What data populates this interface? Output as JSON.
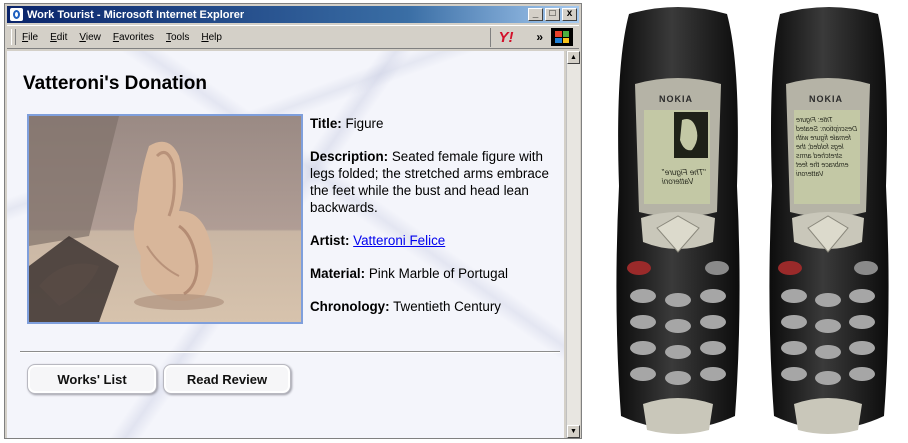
{
  "window": {
    "title": "Work Tourist - Microsoft Internet Explorer",
    "controls": {
      "minimize": "_",
      "maximize": "□",
      "close": "x"
    }
  },
  "menubar": {
    "items": [
      "File",
      "Edit",
      "View",
      "Favorites",
      "Tools",
      "Help"
    ],
    "yahoo_label": "Y!",
    "chevron": "»"
  },
  "page": {
    "title": "Vatteroni's Donation",
    "details": {
      "title_label": "Title:",
      "title_value": "Figure",
      "description_label": "Description:",
      "description_value": "Seated female figure with legs folded; the stretched arms embrace the feet while the bust and head lean backwards.",
      "artist_label": "Artist:",
      "artist_value": "Vatteroni Felice",
      "material_label": "Material:",
      "material_value": "Pink Marble of Portugal",
      "chronology_label": "Chronology:",
      "chronology_value": "Twentieth Century"
    },
    "buttons": {
      "works_list": "Works' List",
      "read_review": "Read Review"
    }
  },
  "phones": [
    {
      "brand": "NOKIA",
      "screen_text": "\"The Figure\"\nVatteroni"
    },
    {
      "brand": "NOKIA",
      "screen_text": "Title: Figure\nDescription: Seated\nfemale figure with\nlegs folded; the\nstretched arms\nembrace the feet\nVatteroni"
    }
  ],
  "colors": {
    "titlebar": "#0a246a",
    "link": "#0000ee",
    "image_border": "#7f9fdc",
    "phone_screen": "#c3c8a5"
  }
}
